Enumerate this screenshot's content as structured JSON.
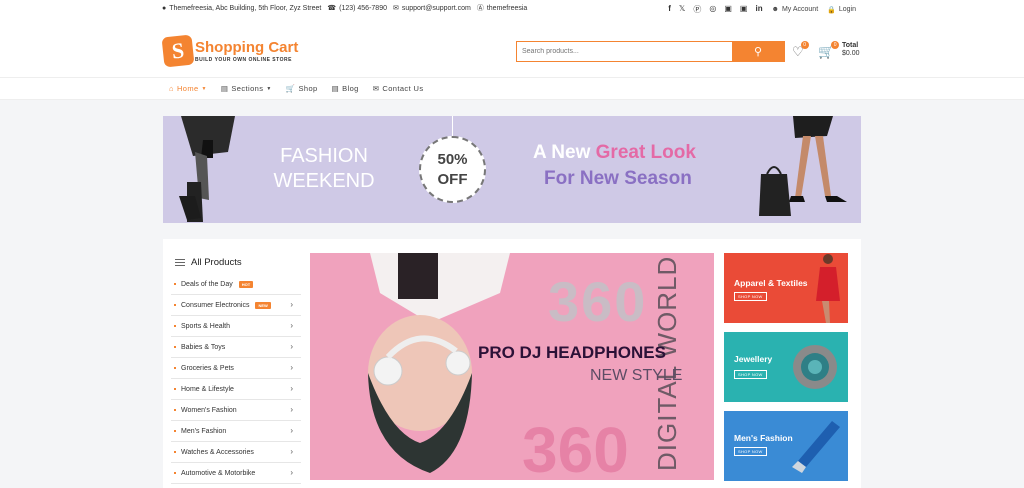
{
  "topbar": {
    "address": "Themefreesia, Abc Building, 5th Floor, Zyz Street",
    "phone": "(123) 456-7890",
    "email": "support@support.com",
    "skype": "themefreesia",
    "social": [
      "facebook-icon",
      "x-icon",
      "pinterest-icon",
      "dribbble-icon",
      "instagram-icon",
      "flickr-icon",
      "linkedin-icon"
    ],
    "my_account": "My Account",
    "login": "Login"
  },
  "header": {
    "logo_title": "Shopping Cart",
    "logo_tagline": "BUILD YOUR OWN ONLINE STORE",
    "search_placeholder": "Search products...",
    "wishlist_count": "0",
    "cart_count": "0",
    "total_label": "Total",
    "total_value": "$0.00",
    "accent": "#f48431"
  },
  "nav": {
    "items": [
      {
        "label": "Home"
      },
      {
        "label": "Sections"
      },
      {
        "label": "Shop"
      },
      {
        "label": "Blog"
      },
      {
        "label": "Contact Us"
      }
    ]
  },
  "banner": {
    "left_line1": "FASHION",
    "left_line2": "WEEKEND",
    "discount_pct": "50%",
    "discount_word": "OFF",
    "headline_a": "A New ",
    "headline_b": "Great Look",
    "subline": "For New Season"
  },
  "sidebar": {
    "title": "All Products",
    "categories": [
      {
        "label": "Deals of the Day",
        "tag": "HOT"
      },
      {
        "label": "Consumer Electronics",
        "tag": "NEW"
      },
      {
        "label": "Sports & Health"
      },
      {
        "label": "Babies & Toys"
      },
      {
        "label": "Groceries & Pets"
      },
      {
        "label": "Home & Lifestyle"
      },
      {
        "label": "Women's Fashion"
      },
      {
        "label": "Men's Fashion"
      },
      {
        "label": "Watches & Accessories"
      },
      {
        "label": "Automotive & Motorbike"
      }
    ]
  },
  "hero": {
    "number_top": "360",
    "number_bottom": "360",
    "vertical_text": "DIGITAL WORLD",
    "title": "PRO DJ HEADPHONES",
    "subtitle": "NEW STYLE"
  },
  "promos": [
    {
      "title": "Apparel & Textiles",
      "button": "SHOP NOW"
    },
    {
      "title": "Jewellery",
      "button": "SHOP NOW"
    },
    {
      "title": "Men's Fashion",
      "button": "SHOP NOW"
    }
  ]
}
